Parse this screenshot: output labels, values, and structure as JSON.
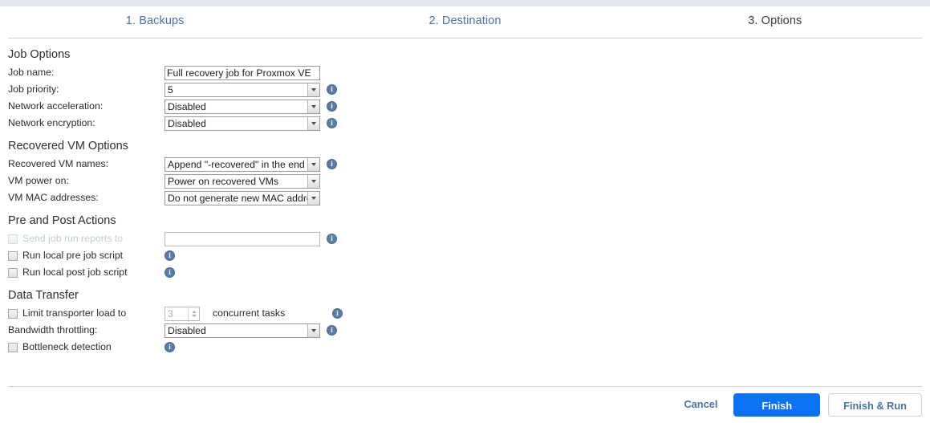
{
  "wizard": {
    "steps": [
      {
        "label": "1. Backups",
        "state": "link"
      },
      {
        "label": "2. Destination",
        "state": "link"
      },
      {
        "label": "3. Options",
        "state": "current"
      }
    ]
  },
  "sections": {
    "job_options": {
      "title": "Job Options",
      "job_name": {
        "label": "Job name:",
        "value": "Full recovery job for Proxmox VE"
      },
      "job_priority": {
        "label": "Job priority:",
        "value": "5"
      },
      "network_acceleration": {
        "label": "Network acceleration:",
        "value": "Disabled"
      },
      "network_encryption": {
        "label": "Network encryption:",
        "value": "Disabled"
      }
    },
    "recovered_vm_options": {
      "title": "Recovered VM Options",
      "vm_names": {
        "label": "Recovered VM names:",
        "value": "Append \"-recovered\" in the end"
      },
      "vm_power_on": {
        "label": "VM power on:",
        "value": "Power on recovered VMs"
      },
      "vm_mac": {
        "label": "VM MAC addresses:",
        "value": "Do not generate new MAC addre ..."
      }
    },
    "pre_post_actions": {
      "title": "Pre and Post Actions",
      "send_reports": {
        "label": "Send job run reports to",
        "value": "",
        "checked": false,
        "disabled": true
      },
      "pre_script": {
        "label": "Run local pre job script",
        "checked": false
      },
      "post_script": {
        "label": "Run local post job script",
        "checked": false
      }
    },
    "data_transfer": {
      "title": "Data Transfer",
      "limit_load": {
        "label": "Limit transporter load to",
        "value": "3",
        "suffix": "concurrent tasks",
        "checked": false,
        "disabled": true
      },
      "bandwidth": {
        "label": "Bandwidth throttling:",
        "value": "Disabled"
      },
      "bottleneck": {
        "label": "Bottleneck detection",
        "checked": false
      }
    }
  },
  "footer": {
    "cancel": "Cancel",
    "finish": "Finish",
    "finish_and_run": "Finish & Run"
  },
  "icons": {
    "info": "i"
  },
  "colors": {
    "accent": "#0b72f5",
    "link": "#4a72a8",
    "info_badge": "#5a7ca5",
    "topstrip": "#e4e7f0"
  }
}
